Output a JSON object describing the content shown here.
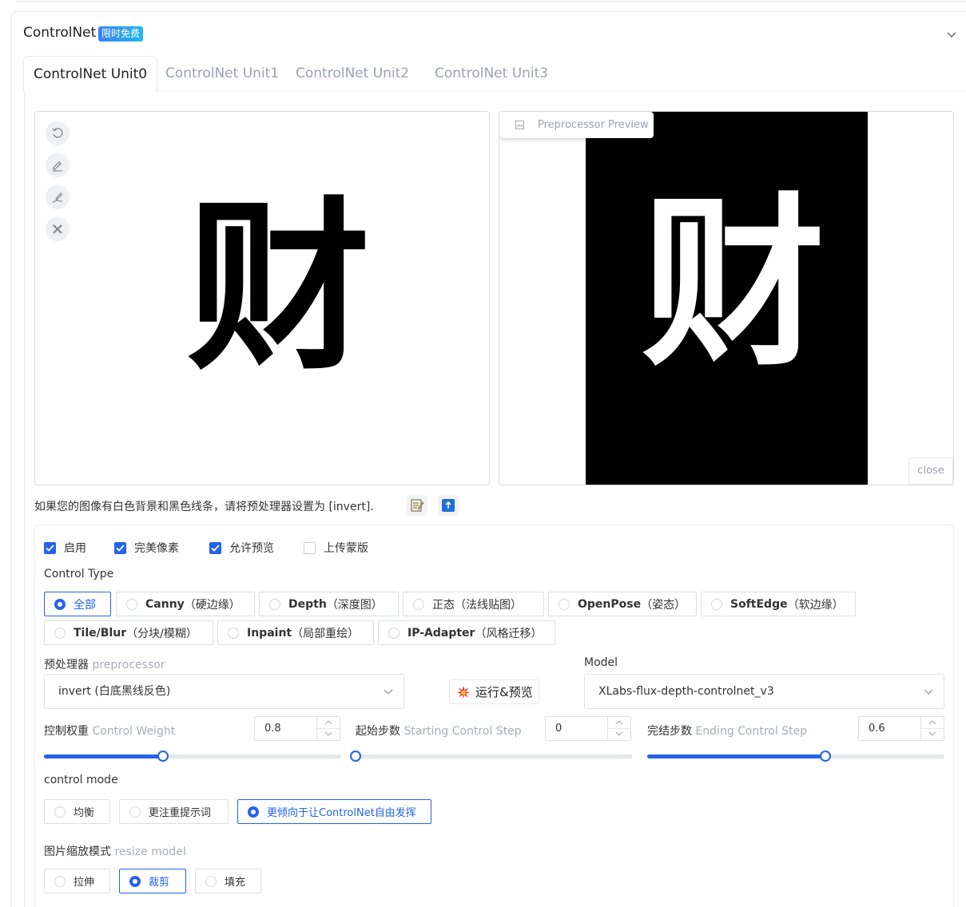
{
  "header": {
    "title": "ControlNet",
    "badge": "限时免费"
  },
  "tabs": [
    {
      "label": "ControlNet Unit0",
      "active": true
    },
    {
      "label": "ControlNet Unit1",
      "active": false
    },
    {
      "label": "ControlNet Unit2",
      "active": false
    },
    {
      "label": "ControlNet Unit3",
      "active": false
    }
  ],
  "image": {
    "glyph": "财"
  },
  "preview": {
    "tag": "Preprocessor Preview",
    "close": "close"
  },
  "hint": {
    "text": "如果您的图像有白色背景和黑色线条，请将预处理器设置为 [invert]."
  },
  "checkboxes": [
    {
      "label": "启用",
      "checked": true
    },
    {
      "label": "完美像素",
      "checked": true
    },
    {
      "label": "允许预览",
      "checked": true
    },
    {
      "label": "上传蒙版",
      "checked": false
    }
  ],
  "control_type": {
    "label": "Control Type",
    "options": [
      {
        "bold": "全部",
        "rest": "",
        "selected": true
      },
      {
        "bold": "Canny",
        "rest": "（硬边缘）",
        "selected": false
      },
      {
        "bold": "Depth",
        "rest": "（深度图）",
        "selected": false
      },
      {
        "bold": "",
        "rest": "正态（法线贴图）",
        "selected": false
      },
      {
        "bold": "OpenPose",
        "rest": "（姿态）",
        "selected": false
      },
      {
        "bold": "SoftEdge",
        "rest": "（软边缘）",
        "selected": false
      },
      {
        "bold": "Tile/Blur",
        "rest": "（分块/模糊）",
        "selected": false
      },
      {
        "bold": "Inpaint",
        "rest": "（局部重绘）",
        "selected": false
      },
      {
        "bold": "IP-Adapter",
        "rest": "（风格迁移）",
        "selected": false
      }
    ]
  },
  "preprocessor": {
    "label_cn": "预处理器",
    "label_en": "preprocessor",
    "value": "invert (白底黑线反色)"
  },
  "run_button": {
    "label": "运行&预览"
  },
  "model": {
    "label": "Model",
    "value": "XLabs-flux-depth-controlnet_v3"
  },
  "sliders": [
    {
      "label_cn": "控制权重",
      "label_en": "Control Weight",
      "value": "0.8",
      "min": 0,
      "max": 2
    },
    {
      "label_cn": "起始步数",
      "label_en": "Starting Control Step",
      "value": "0",
      "min": 0,
      "max": 1
    },
    {
      "label_cn": "完结步数",
      "label_en": "Ending Control Step",
      "value": "0.6",
      "min": 0,
      "max": 1
    }
  ],
  "control_mode": {
    "label": "control mode",
    "options": [
      {
        "label": "均衡",
        "selected": false
      },
      {
        "label": "更注重提示词",
        "selected": false
      },
      {
        "label": "更倾向于让ControlNet自由发挥",
        "selected": true
      }
    ]
  },
  "resize_mode": {
    "label_cn": "图片缩放模式",
    "label_en": "resize model",
    "options": [
      {
        "label": "拉伸",
        "selected": false
      },
      {
        "label": "裁剪",
        "selected": true
      },
      {
        "label": "填充",
        "selected": false
      }
    ]
  },
  "colors": {
    "accent": "#2563eb",
    "border": "#e5e7eb",
    "muted": "#9ca3af"
  }
}
